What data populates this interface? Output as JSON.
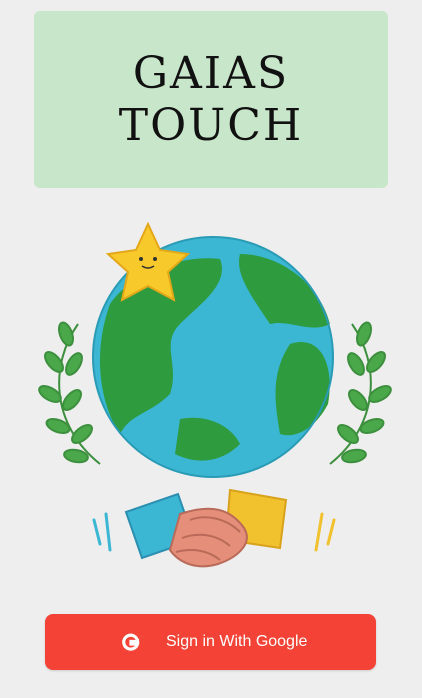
{
  "title": {
    "line1": "GAIAS",
    "line2": "TOUCH"
  },
  "illustration": {
    "elements": [
      "earth-globe-icon",
      "star-icon",
      "laurel-icon",
      "handshake-icon"
    ]
  },
  "signin": {
    "icon": "google-g-icon",
    "label": "Sign in With Google"
  },
  "colors": {
    "background": "#eeeeee",
    "title_card": "#c8e6c9",
    "button": "#f44336",
    "ocean": "#3bb6d3",
    "land": "#2e9b3e",
    "star": "#f8c92a",
    "leaf": "#4aa84a"
  }
}
